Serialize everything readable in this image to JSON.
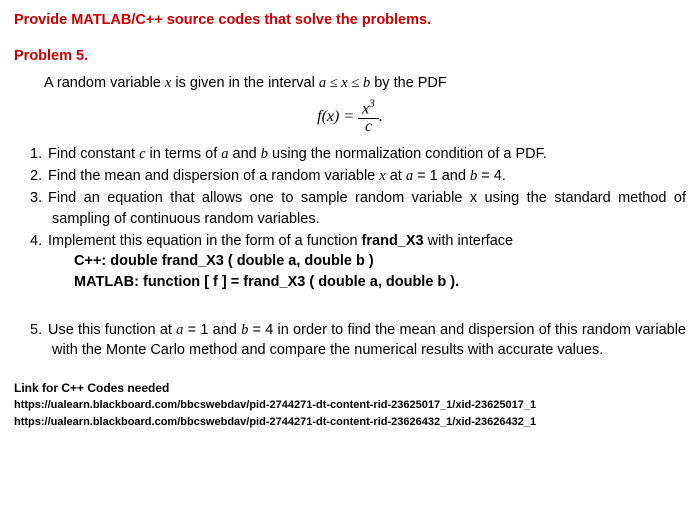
{
  "title": "Provide MATLAB/C++ source codes that solve the problems.",
  "problem_heading": "Problem 5.",
  "intro": {
    "prefix": "A random variable ",
    "var": "x",
    "mid": " is given in the interval  ",
    "range": "a ≤ x ≤ b",
    "suffix": " by the PDF"
  },
  "equation": {
    "lhs": "f(x) = ",
    "num": "x",
    "num_sup": "3",
    "den": "c",
    "tail": "."
  },
  "items": {
    "i1": {
      "num": "1.",
      "p1": "Find constant ",
      "v1": "c",
      "p2": " in terms of ",
      "v2": "a",
      "p3": " and ",
      "v3": "b",
      "p4": " using the normalization condition of a PDF."
    },
    "i2": {
      "num": "2.",
      "p1": "Find the mean and dispersion of a random variable ",
      "v1": "x",
      "p2": " at ",
      "v2": "a",
      "p3": " = 1 and ",
      "v3": "b",
      "p4": " = 4."
    },
    "i3": {
      "num": "3.",
      "text": "Find an equation that allows one to sample random variable x using the standard method of sampling of continuous random variables."
    },
    "i4": {
      "num": "4.",
      "p1": "Implement this equation in the form of a function ",
      "b1": "frand_X3",
      "p2": " with interface",
      "l1": "C++: double frand_X3 ( double a, double b )",
      "l2": "MATLAB: function [ f ] = frand_X3 ( double a, double b )."
    },
    "i5": {
      "num": "5.",
      "p1": "Use this function at ",
      "v1": "a",
      "p2": " = 1 and ",
      "v2": "b",
      "p3": " = 4 in order to find the mean and dispersion of this random variable with the Monte Carlo method and compare the numerical results with accurate values."
    }
  },
  "links": {
    "heading": "Link for C++ Codes needed",
    "l1": "https://ualearn.blackboard.com/bbcswebdav/pid-2744271-dt-content-rid-23625017_1/xid-23625017_1",
    "l2": "https://ualearn.blackboard.com/bbcswebdav/pid-2744271-dt-content-rid-23626432_1/xid-23626432_1"
  }
}
